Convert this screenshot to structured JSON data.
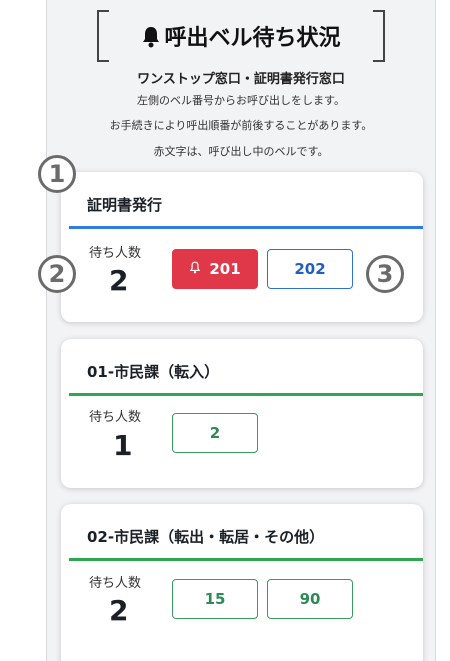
{
  "header": {
    "title": "呼出ベル待ち状況",
    "subtitle": "ワンストップ窓口・証明書発行窓口",
    "info_lines": [
      "左側のベル番号からお呼び出しをします。",
      "お手続きにより呼出順番が前後することがあります。",
      "赤文字は、呼び出し中のベルです。"
    ]
  },
  "wait_label": "待ち人数",
  "cards": [
    {
      "title": "証明書発行",
      "accent": "#2f7de1",
      "waiting": "2",
      "numbers": [
        "201",
        "202"
      ],
      "calling": "201"
    },
    {
      "title": "01-市民課（転入）",
      "accent": "#2ea84f",
      "waiting": "1",
      "numbers": [
        "2"
      ]
    },
    {
      "title": "02-市民課（転出・転居・その他）",
      "accent": "#2ea84f",
      "waiting": "2",
      "numbers": [
        "15",
        "90"
      ]
    }
  ],
  "markers": [
    "1",
    "2",
    "3"
  ],
  "colors": {
    "calling": "#e03848",
    "blue": "#2f6fd6",
    "green": "#3b9a60",
    "background": "#f2f3f5"
  }
}
